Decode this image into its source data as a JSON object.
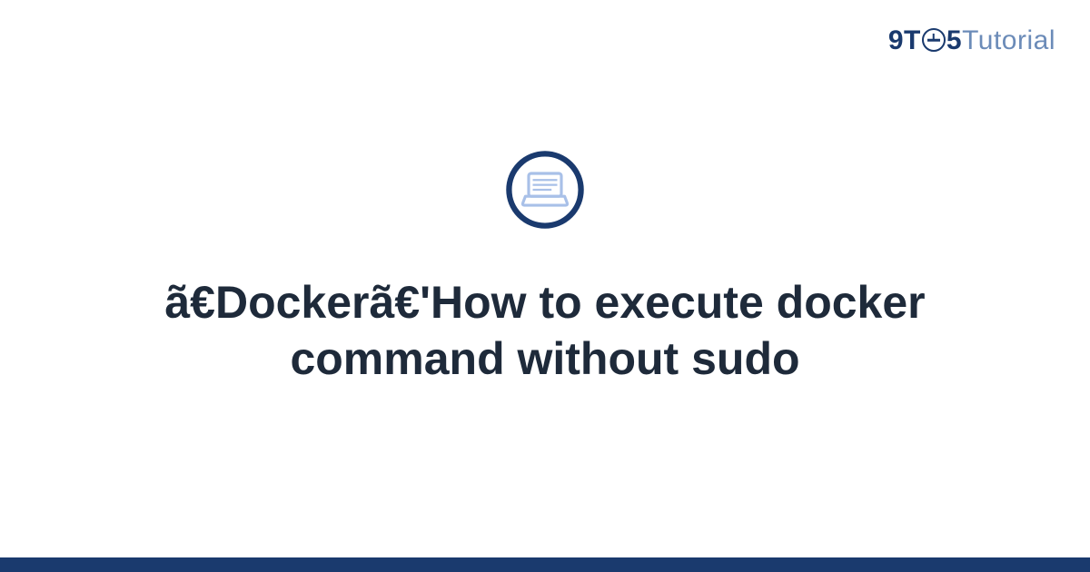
{
  "brand": {
    "prefix": "9T",
    "middle_digit": "5",
    "suffix": "Tutorial"
  },
  "hero": {
    "icon_name": "laptop-icon"
  },
  "article": {
    "title": "ã€Dockerã€'How to execute docker command without sudo"
  },
  "colors": {
    "primary": "#1a3a6e",
    "secondary": "#6b8bb8",
    "text": "#1e2a3a",
    "icon_accent": "#a8c0e8"
  }
}
